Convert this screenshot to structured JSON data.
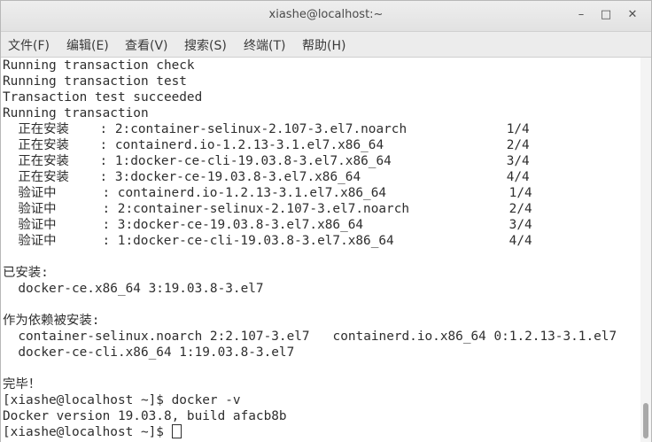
{
  "window": {
    "title": "xiashe@localhost:~",
    "minimize": "–",
    "maximize": "□",
    "close": "✕"
  },
  "menu": [
    "文件(F)",
    "编辑(E)",
    "查看(V)",
    "搜索(S)",
    "终端(T)",
    "帮助(H)"
  ],
  "terminal": {
    "lines": [
      "Running transaction check",
      "Running transaction test",
      "Transaction test succeeded",
      "Running transaction",
      "  正在安装    : 2:container-selinux-2.107-3.el7.noarch             1/4",
      "  正在安装    : containerd.io-1.2.13-3.1.el7.x86_64                2/4",
      "  正在安装    : 1:docker-ce-cli-19.03.8-3.el7.x86_64               3/4",
      "  正在安装    : 3:docker-ce-19.03.8-3.el7.x86_64                   4/4",
      "  验证中      : containerd.io-1.2.13-3.1.el7.x86_64                1/4",
      "  验证中      : 2:container-selinux-2.107-3.el7.noarch             2/4",
      "  验证中      : 3:docker-ce-19.03.8-3.el7.x86_64                   3/4",
      "  验证中      : 1:docker-ce-cli-19.03.8-3.el7.x86_64               4/4",
      "",
      "已安装:",
      "  docker-ce.x86_64 3:19.03.8-3.el7",
      "",
      "作为依赖被安装:",
      "  container-selinux.noarch 2:2.107-3.el7   containerd.io.x86_64 0:1.2.13-3.1.el7",
      "  docker-ce-cli.x86_64 1:19.03.8-3.el7",
      "",
      "完毕！",
      "[xiashe@localhost ~]$ docker -v",
      "Docker version 19.03.8, build afacb8b"
    ],
    "prompt": "[xiashe@localhost ~]$ "
  }
}
